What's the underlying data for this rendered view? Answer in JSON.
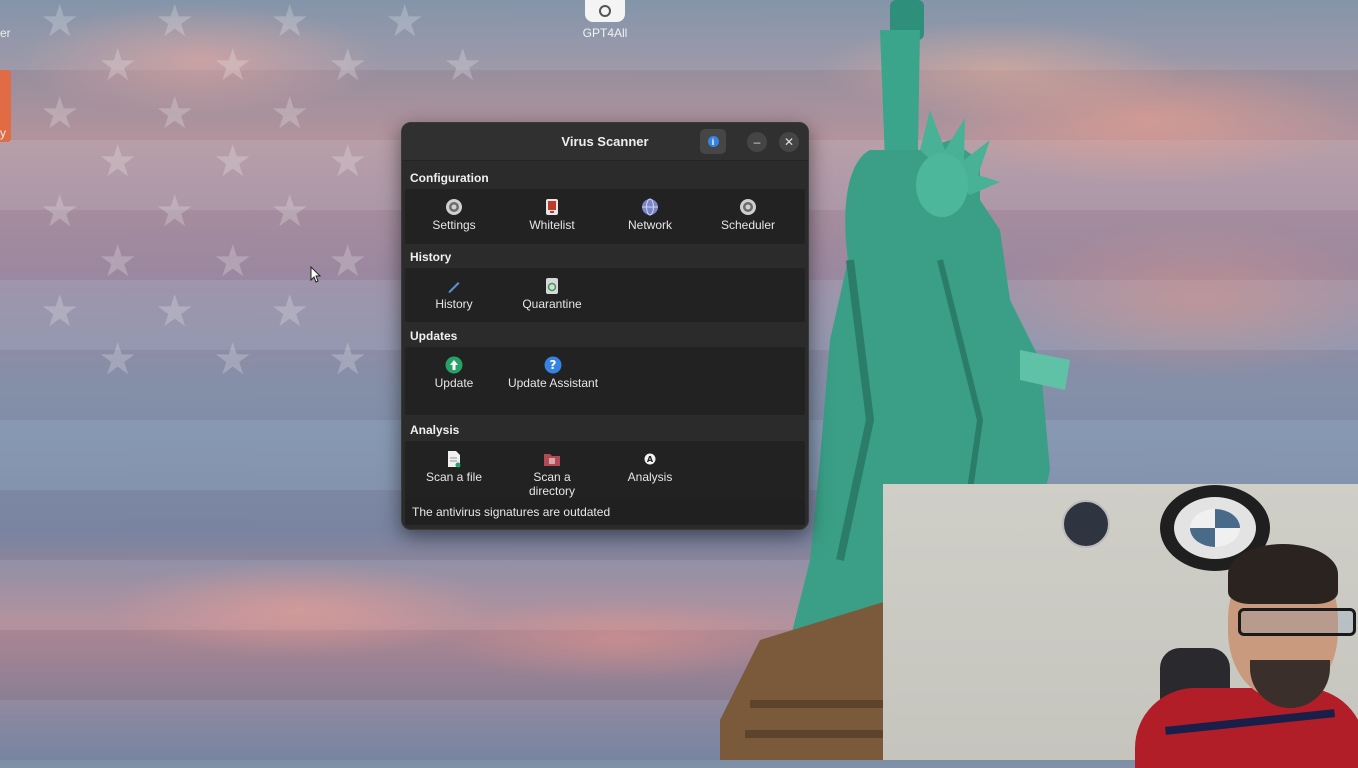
{
  "desktop": {
    "left_partial_label_top": "er",
    "left_partial_label_mid": "y",
    "gpt_icon_label": "GPT4All"
  },
  "window": {
    "title": "Virus Scanner",
    "minimize_symbol": "–",
    "close_symbol": "✕",
    "info_symbol": "i",
    "sections": [
      {
        "title": "Configuration",
        "items": [
          "Settings",
          "Whitelist",
          "Network",
          "Scheduler"
        ]
      },
      {
        "title": "History",
        "items": [
          "History",
          "Quarantine"
        ]
      },
      {
        "title": "Updates",
        "items": [
          "Update",
          "Update Assistant"
        ]
      },
      {
        "title": "Analysis",
        "items": [
          "Scan a file",
          "Scan a directory",
          "Analysis"
        ]
      }
    ],
    "status": "The antivirus signatures are outdated"
  },
  "colors": {
    "window_bg": "#2b2b2b",
    "row_bg": "#222222",
    "accent_blue": "#3584e4",
    "update_green": "#26a269",
    "whitelist_red": "#c0392b"
  }
}
